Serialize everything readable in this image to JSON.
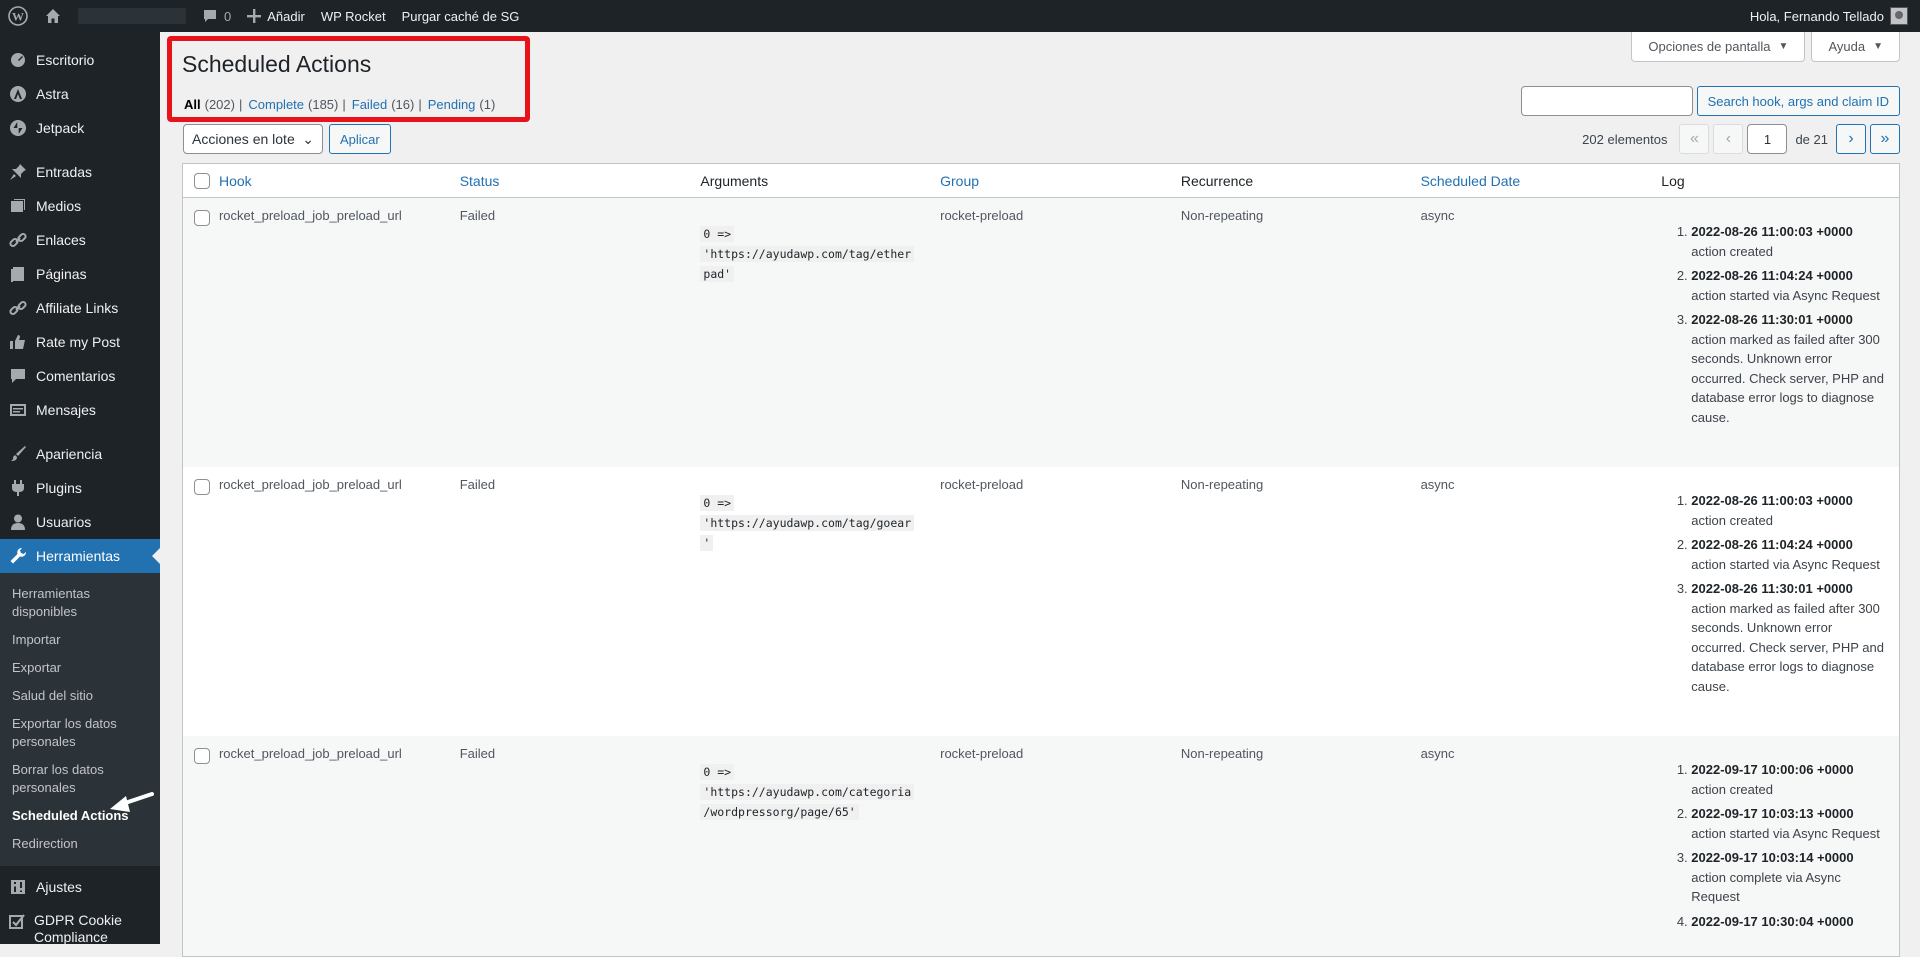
{
  "adminbar": {
    "comments_count": "0",
    "add_label": "Añadir",
    "wp_rocket": "WP Rocket",
    "purge_sg": "Purgar caché de SG",
    "greeting": "Hola, Fernando Tellado"
  },
  "sidebar": {
    "items": [
      {
        "label": "Escritorio",
        "icon": "dashboard-icon"
      },
      {
        "label": "Astra",
        "icon": "astra-icon"
      },
      {
        "label": "Jetpack",
        "icon": "jetpack-icon"
      },
      {
        "label": "Entradas",
        "icon": "pin-icon"
      },
      {
        "label": "Medios",
        "icon": "media-icon"
      },
      {
        "label": "Enlaces",
        "icon": "link-icon"
      },
      {
        "label": "Páginas",
        "icon": "page-icon"
      },
      {
        "label": "Affiliate Links",
        "icon": "link-icon"
      },
      {
        "label": "Rate my Post",
        "icon": "thumbs-up-icon"
      },
      {
        "label": "Comentarios",
        "icon": "comment-icon"
      },
      {
        "label": "Mensajes",
        "icon": "messages-icon"
      },
      {
        "label": "Apariencia",
        "icon": "brush-icon"
      },
      {
        "label": "Plugins",
        "icon": "plugin-icon"
      },
      {
        "label": "Usuarios",
        "icon": "user-icon"
      },
      {
        "label": "Herramientas",
        "icon": "wrench-icon"
      },
      {
        "label": "Ajustes",
        "icon": "settings-icon"
      },
      {
        "label": "GDPR Cookie Compliance",
        "icon": "check-icon"
      }
    ],
    "submenu": [
      "Herramientas disponibles",
      "Importar",
      "Exportar",
      "Salud del sitio",
      "Exportar los datos personales",
      "Borrar los datos personales",
      "Scheduled Actions",
      "Redirection"
    ]
  },
  "screen_meta": {
    "options": "Opciones de pantalla",
    "help": "Ayuda"
  },
  "page": {
    "title": "Scheduled Actions",
    "filters": [
      {
        "label": "All",
        "count": "(202)"
      },
      {
        "label": "Complete",
        "count": "(185)"
      },
      {
        "label": "Failed",
        "count": "(16)"
      },
      {
        "label": "Pending",
        "count": "(1)"
      }
    ],
    "search_button": "Search hook, args and claim ID",
    "search_value": "",
    "bulk_select": "Acciones en lote",
    "apply": "Aplicar",
    "items_count": "202 elementos",
    "current_page": "1",
    "of_pages": "de 21"
  },
  "table": {
    "headers": [
      "Hook",
      "Status",
      "Arguments",
      "Group",
      "Recurrence",
      "Scheduled Date",
      "Log"
    ],
    "rows": [
      {
        "hook": "rocket_preload_job_preload_url",
        "status": "Failed",
        "args": [
          "0 =>",
          "'https://ayudawp.com/tag/ether",
          "pad'"
        ],
        "group": "rocket-preload",
        "recurrence": "Non-repeating",
        "date": "async",
        "log": [
          {
            "ts": "2022-08-26 11:00:03 +0000",
            "msg": "action created"
          },
          {
            "ts": "2022-08-26 11:04:24 +0000",
            "msg": "action started via Async Request"
          },
          {
            "ts": "2022-08-26 11:30:01 +0000",
            "msg": "action marked as failed after 300 seconds. Unknown error occurred. Check server, PHP and database error logs to diagnose cause."
          }
        ]
      },
      {
        "hook": "rocket_preload_job_preload_url",
        "status": "Failed",
        "args": [
          "0 =>",
          "'https://ayudawp.com/tag/goear",
          "'"
        ],
        "group": "rocket-preload",
        "recurrence": "Non-repeating",
        "date": "async",
        "log": [
          {
            "ts": "2022-08-26 11:00:03 +0000",
            "msg": "action created"
          },
          {
            "ts": "2022-08-26 11:04:24 +0000",
            "msg": "action started via Async Request"
          },
          {
            "ts": "2022-08-26 11:30:01 +0000",
            "msg": "action marked as failed after 300 seconds. Unknown error occurred. Check server, PHP and database error logs to diagnose cause."
          }
        ]
      },
      {
        "hook": "rocket_preload_job_preload_url",
        "status": "Failed",
        "args": [
          "0 =>",
          "'https://ayudawp.com/categoria",
          "/wordpressorg/page/65'"
        ],
        "group": "rocket-preload",
        "recurrence": "Non-repeating",
        "date": "async",
        "log": [
          {
            "ts": "2022-09-17 10:00:06 +0000",
            "msg": "action created"
          },
          {
            "ts": "2022-09-17 10:03:13 +0000",
            "msg": "action started via Async Request"
          },
          {
            "ts": "2022-09-17 10:03:14 +0000",
            "msg": "action complete via Async Request"
          },
          {
            "ts": "2022-09-17 10:30:04 +0000",
            "msg": ""
          }
        ]
      }
    ]
  }
}
